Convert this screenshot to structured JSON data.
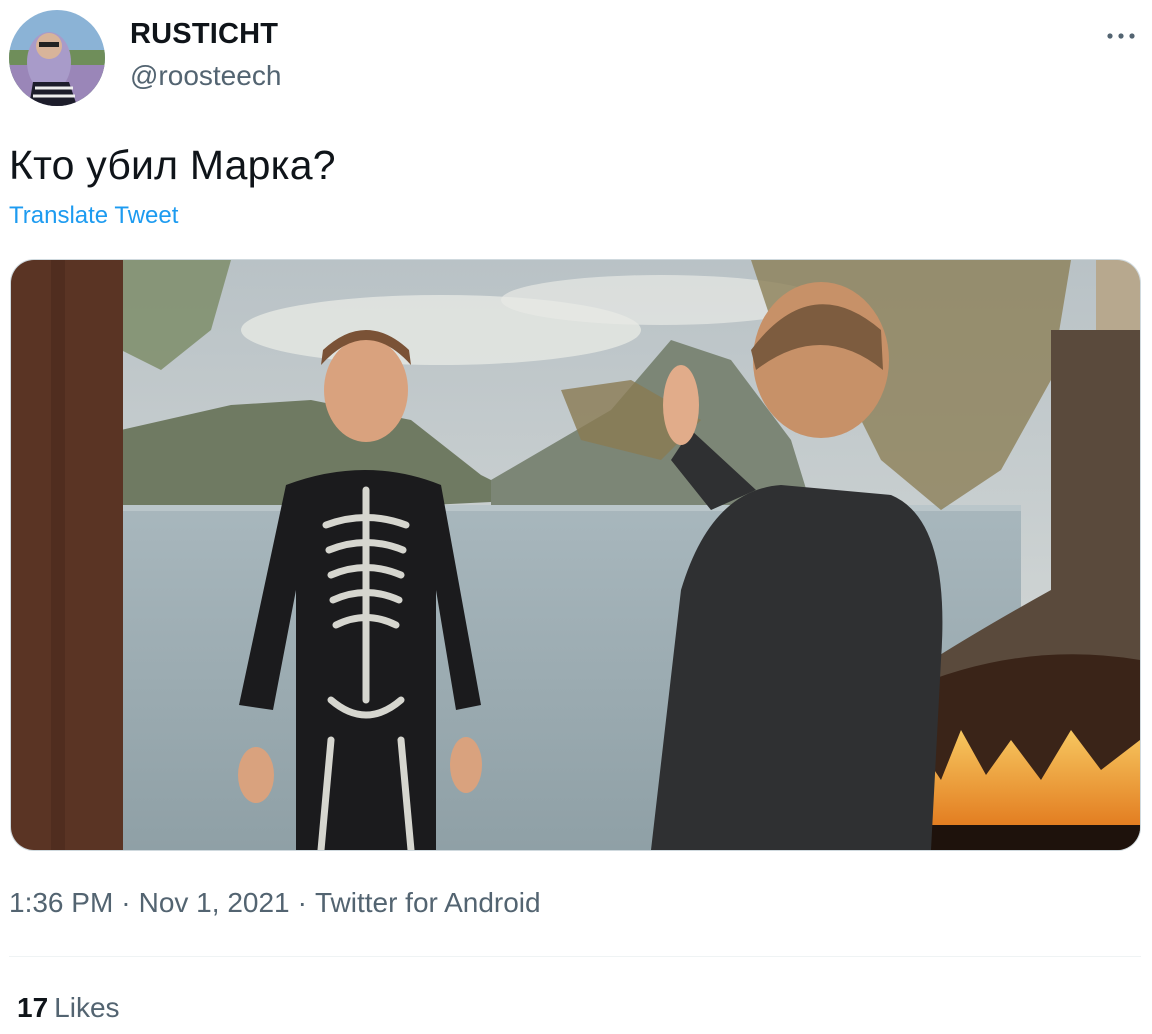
{
  "author": {
    "display_name": "RUSTICHT",
    "handle": "@roosteech",
    "avatar_icon": "profile-photo-avatar"
  },
  "more_icon": "more-dots-icon",
  "tweet": {
    "text": "Кто убил Марка?",
    "translate_label": "Translate Tweet",
    "media_icon": "tweet-photo"
  },
  "meta": {
    "time": "1:36 PM",
    "date": "Nov 1, 2021",
    "source": "Twitter for Android",
    "separator": "·"
  },
  "stats": {
    "likes_count": "17",
    "likes_label": "Likes"
  },
  "colors": {
    "link": "#1d9bf0",
    "secondary_text": "#536471",
    "primary_text": "#0f1419"
  }
}
